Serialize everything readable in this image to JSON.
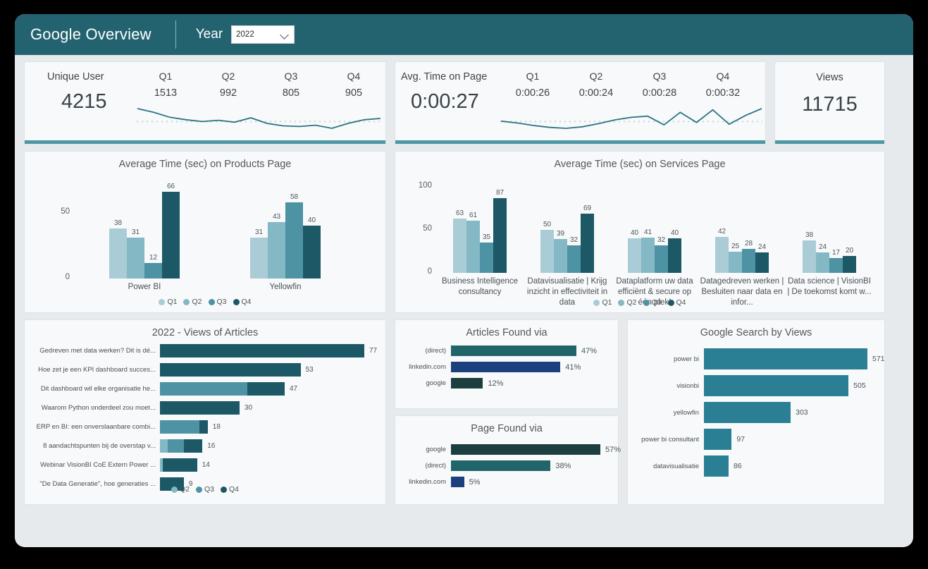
{
  "header": {
    "app_title": "Google Overview",
    "year_label": "Year",
    "year_value": "2022",
    "chevron_icon": "chevron-down-icon",
    "bg_color": "#236370"
  },
  "colors": {
    "q1": "#a9ccd6",
    "q2": "#83b8c4",
    "q3": "#4d93a4",
    "q4": "#1d5866",
    "accent": "#4e97a5",
    "teal": "#21656b",
    "navy": "#1c3f7e",
    "dark_green": "#1d3e3e",
    "search_bar": "#2a7f95"
  },
  "kpi_users": {
    "name": "Unique User",
    "total": "4215",
    "quarters": [
      "Q1",
      "Q2",
      "Q3",
      "Q4"
    ],
    "values": [
      "1513",
      "992",
      "805",
      "905"
    ],
    "sparkline": [
      62,
      56,
      48,
      44,
      41,
      43,
      40,
      47,
      38,
      34,
      33,
      35,
      30,
      38,
      44,
      46
    ]
  },
  "kpi_time": {
    "name": "Avg. Time on Page",
    "total": "0:00:27",
    "quarters": [
      "Q1",
      "Q2",
      "Q3",
      "Q4"
    ],
    "values": [
      "0:00:26",
      "0:00:24",
      "0:00:28",
      "0:00:32"
    ],
    "sparkline": [
      40,
      34,
      26,
      20,
      17,
      22,
      32,
      44,
      52,
      56,
      28,
      68,
      36,
      76,
      30,
      58,
      80
    ]
  },
  "kpi_views": {
    "name": "Views",
    "total": "11715"
  },
  "chart_data": [
    {
      "type": "bar",
      "name": "products-page",
      "title": "Average Time (sec) on Products Page",
      "categories": [
        "Power BI",
        "Yellowfin"
      ],
      "series": [
        {
          "name": "Q1",
          "values": [
            38,
            31
          ]
        },
        {
          "name": "Q2",
          "values": [
            31,
            43
          ]
        },
        {
          "name": "Q3",
          "values": [
            12,
            58
          ]
        },
        {
          "name": "Q4",
          "values": [
            66,
            40
          ]
        }
      ],
      "ylim": [
        0,
        75
      ],
      "yticks": [
        0,
        50
      ],
      "ylabel": "",
      "xlabel": "",
      "legend": [
        "Q1",
        "Q2",
        "Q3",
        "Q4"
      ],
      "legend_position": "bottom",
      "grid": false
    },
    {
      "type": "bar",
      "name": "services-page",
      "title": "Average Time (sec) on Services Page",
      "categories": [
        "Business Intelligence consultancy",
        "Datavisualisatie | Krijg inzicht in effectiviteit in data",
        "Dataplatform uw data efficiënt & secure op één plek!",
        "Datagedreven werken | Besluiten naar data en infor...",
        "Data science | VisionBI | De toekomst komt w..."
      ],
      "series": [
        {
          "name": "Q1",
          "values": [
            63,
            50,
            40,
            42,
            38
          ]
        },
        {
          "name": "Q2",
          "values": [
            61,
            39,
            41,
            25,
            24
          ]
        },
        {
          "name": "Q3",
          "values": [
            35,
            32,
            32,
            28,
            17
          ]
        },
        {
          "name": "Q4",
          "values": [
            87,
            69,
            40,
            24,
            20
          ]
        }
      ],
      "ylim": [
        0,
        110
      ],
      "yticks": [
        0,
        50,
        100
      ],
      "ylabel": "",
      "xlabel": "",
      "legend": [
        "Q1",
        "Q2",
        "Q3",
        "Q4"
      ],
      "legend_position": "bottom",
      "grid": false
    },
    {
      "type": "bar",
      "name": "views-of-articles",
      "title": "2022 - Views of Articles",
      "orientation": "horizontal",
      "stacked": true,
      "categories": [
        "Gedreven met data werken? Dit is dé...",
        "Hoe zet je een KPI dashboard succes...",
        "Dit dashboard wil elke organisatie he...",
        "Waarom Python onderdeel zou moet...",
        "ERP en BI: een onverslaanbare combi...",
        "8 aandachtspunten bij de overstap v...",
        "Webinar VisionBI CoE Extern Power ...",
        "\"De Data Generatie\", hoe generaties ..."
      ],
      "totals": [
        77,
        53,
        47,
        30,
        18,
        16,
        14,
        9
      ],
      "series": [
        {
          "name": "Q2",
          "values": [
            0,
            0,
            0,
            0,
            0,
            3,
            1,
            0
          ]
        },
        {
          "name": "Q3",
          "values": [
            0,
            0,
            33,
            0,
            15,
            6,
            0,
            0
          ]
        },
        {
          "name": "Q4",
          "values": [
            77,
            53,
            14,
            30,
            3,
            7,
            13,
            9
          ]
        }
      ],
      "legend": [
        "Q2",
        "Q3",
        "Q4"
      ],
      "legend_position": "bottom",
      "xlim": [
        0,
        77
      ],
      "grid": false
    },
    {
      "type": "bar",
      "name": "articles-found-via",
      "title": "Articles Found via",
      "orientation": "horizontal",
      "categories": [
        "(direct)",
        "linkedin.com",
        "google"
      ],
      "values": [
        47,
        41,
        12
      ],
      "value_labels": [
        "47%",
        "41%",
        "12%"
      ],
      "bar_colors": [
        "#21656b",
        "#1c3f7e",
        "#1d3e3e"
      ],
      "xlim": [
        0,
        47
      ],
      "grid": false
    },
    {
      "type": "bar",
      "name": "page-found-via",
      "title": "Page Found via",
      "orientation": "horizontal",
      "categories": [
        "google",
        "(direct)",
        "linkedin.com"
      ],
      "values": [
        57,
        38,
        5
      ],
      "value_labels": [
        "57%",
        "38%",
        "5%"
      ],
      "bar_colors": [
        "#1d3e3e",
        "#21656b",
        "#1c3f7e"
      ],
      "xlim": [
        0,
        57
      ],
      "grid": false
    },
    {
      "type": "bar",
      "name": "google-search-by-views",
      "title": "Google Search by Views",
      "orientation": "horizontal",
      "categories": [
        "power bi",
        "visionbi",
        "yellowfin",
        "power bi consultant",
        "datavisualisatie"
      ],
      "values": [
        571,
        505,
        303,
        97,
        86
      ],
      "value_labels": [
        "571",
        "505",
        "303",
        "97",
        "86"
      ],
      "bar_color": "#2a7f95",
      "xlim": [
        0,
        571
      ],
      "grid": false
    }
  ]
}
